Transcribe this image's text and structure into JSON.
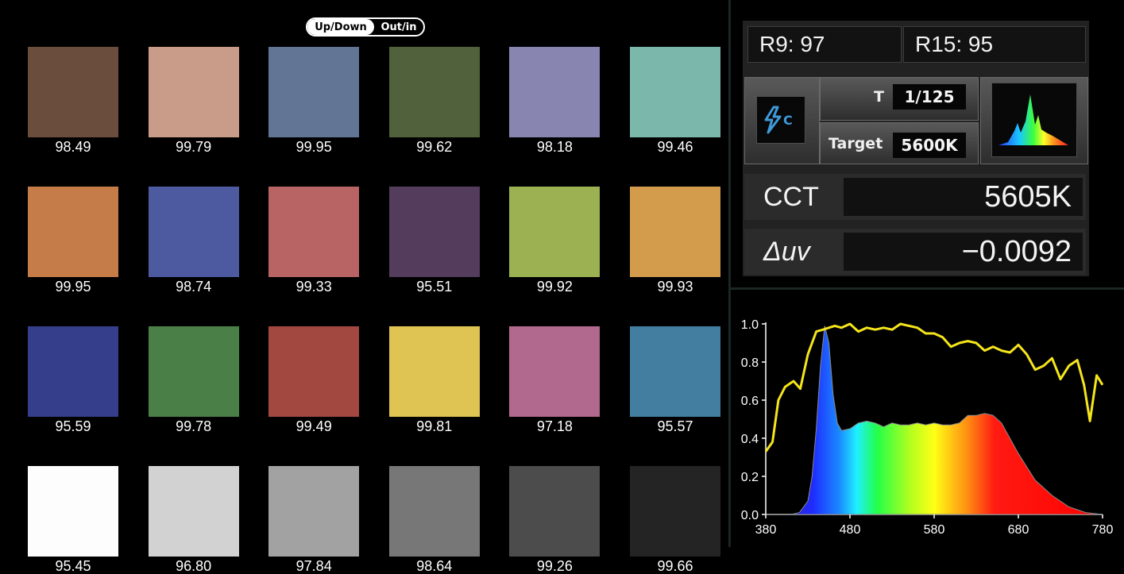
{
  "toggle": {
    "option_a": "Up/Down",
    "option_b": "Out/in",
    "selected": "Up/Down"
  },
  "swatches": [
    {
      "color": "#6b4d3e",
      "value": "98.49"
    },
    {
      "color": "#c89c89",
      "value": "99.79"
    },
    {
      "color": "#627594",
      "value": "99.95"
    },
    {
      "color": "#50613c",
      "value": "99.62"
    },
    {
      "color": "#8886b0",
      "value": "98.18"
    },
    {
      "color": "#7bb8ab",
      "value": "99.46"
    },
    {
      "color": "#c67c48",
      "value": "99.95"
    },
    {
      "color": "#4e5aa0",
      "value": "98.74"
    },
    {
      "color": "#b86364",
      "value": "99.33"
    },
    {
      "color": "#533c5c",
      "value": "95.51"
    },
    {
      "color": "#9cb252",
      "value": "99.92"
    },
    {
      "color": "#d39c4c",
      "value": "99.93"
    },
    {
      "color": "#343e8a",
      "value": "95.59"
    },
    {
      "color": "#4a8047",
      "value": "99.78"
    },
    {
      "color": "#a34840",
      "value": "99.49"
    },
    {
      "color": "#e0c453",
      "value": "99.81"
    },
    {
      "color": "#b2698e",
      "value": "97.18"
    },
    {
      "color": "#437ea0",
      "value": "95.57"
    },
    {
      "color": "#fdfdfd",
      "value": "95.45"
    },
    {
      "color": "#d2d2d2",
      "value": "96.80"
    },
    {
      "color": "#a2a2a2",
      "value": "97.84"
    },
    {
      "color": "#777777",
      "value": "98.64"
    },
    {
      "color": "#4c4c4c",
      "value": "99.26"
    },
    {
      "color": "#242424",
      "value": "99.66"
    }
  ],
  "readings": {
    "r9": "R9: 97",
    "r15": "R15: 95",
    "mode_icon": "flash-c-icon",
    "t_label": "T",
    "t_value": "1/125",
    "target_label": "Target",
    "target_value": "5600K",
    "spectrum_icon": "spectrum-icon",
    "cct_label": "CCT",
    "cct_value": "5605K",
    "duv_label": "Δuv",
    "duv_value": "−0.0092"
  },
  "chart_data": {
    "type": "line",
    "xlim": [
      380,
      780
    ],
    "ylim": [
      0,
      1
    ],
    "xticks": [
      "380",
      "480",
      "580",
      "680",
      "780"
    ],
    "yticks": [
      "0.0",
      "0.2",
      "0.4",
      "0.6",
      "0.8",
      "1.0"
    ],
    "series": [
      {
        "color": "#f5e51b",
        "x": [
          380,
          388,
          395,
          403,
          413,
          421,
          430,
          440,
          448,
          455,
          462,
          470,
          480,
          490,
          500,
          510,
          520,
          530,
          540,
          550,
          560,
          570,
          580,
          590,
          600,
          610,
          620,
          630,
          640,
          650,
          660,
          670,
          680,
          690,
          700,
          710,
          720,
          730,
          740,
          750,
          758,
          765,
          773,
          780
        ],
        "values": [
          0.33,
          0.38,
          0.6,
          0.67,
          0.7,
          0.66,
          0.84,
          0.96,
          0.97,
          0.98,
          0.99,
          0.98,
          1.0,
          0.96,
          0.98,
          0.97,
          0.98,
          0.97,
          1.0,
          0.99,
          0.98,
          0.95,
          0.95,
          0.93,
          0.88,
          0.9,
          0.91,
          0.9,
          0.86,
          0.88,
          0.86,
          0.85,
          0.89,
          0.84,
          0.76,
          0.78,
          0.82,
          0.71,
          0.78,
          0.81,
          0.68,
          0.49,
          0.73,
          0.68
        ]
      },
      {
        "type": "area",
        "x": [
          380,
          410,
          420,
          430,
          435,
          440,
          445,
          450,
          455,
          460,
          465,
          470,
          480,
          490,
          500,
          510,
          520,
          530,
          540,
          550,
          560,
          570,
          580,
          590,
          600,
          610,
          620,
          630,
          640,
          650,
          660,
          670,
          680,
          690,
          700,
          720,
          740,
          760,
          780
        ],
        "values": [
          0.0,
          0.0,
          0.01,
          0.07,
          0.2,
          0.45,
          0.78,
          0.99,
          0.9,
          0.63,
          0.48,
          0.44,
          0.45,
          0.48,
          0.49,
          0.48,
          0.46,
          0.48,
          0.47,
          0.47,
          0.48,
          0.47,
          0.48,
          0.47,
          0.47,
          0.48,
          0.52,
          0.52,
          0.53,
          0.52,
          0.48,
          0.4,
          0.32,
          0.25,
          0.18,
          0.1,
          0.04,
          0.01,
          0.0
        ]
      }
    ]
  }
}
